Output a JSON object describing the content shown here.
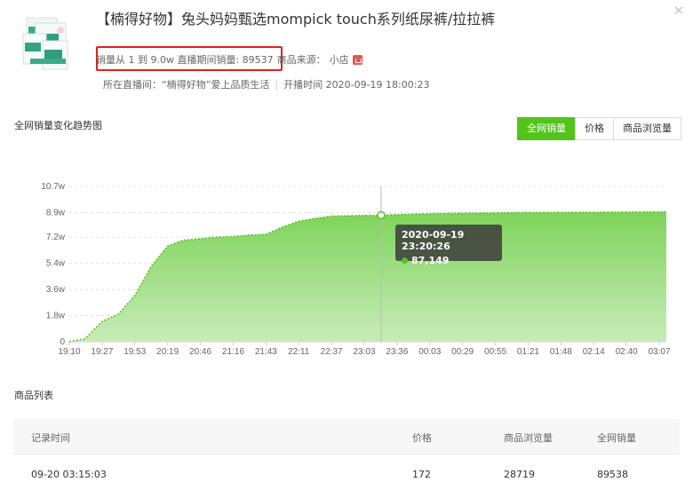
{
  "product": {
    "title": "【楠得好物】兔头妈妈甄选mompick touch系列纸尿裤/拉拉裤",
    "sales_summary": "销量从 1 到 9.0w 直播期间销量: 89537",
    "source_label": "商品来源：",
    "source_value": "小店",
    "live_label": "所在直播间：",
    "live_room": "“楠得好物”爱上品质生活",
    "live_time_label": "开播时间",
    "live_time": "2020-09-19 18:00:23"
  },
  "chart_section": {
    "title": "全网销量变化趋势图",
    "tabs": [
      "全网销量",
      "价格",
      "商品浏览量"
    ],
    "active_tab": "全网销量"
  },
  "tooltip": {
    "time": "2020-09-19 23:20:26",
    "value": "87,149"
  },
  "colors": {
    "accent": "#52c41a",
    "area_top": "#7ed35a",
    "area_bottom": "#c8ecb8",
    "highlight_box": "#e02020"
  },
  "chart_data": {
    "type": "area",
    "title": "全网销量变化趋势图",
    "xlabel": "",
    "ylabel": "",
    "x_ticks": [
      "19:10",
      "19:27",
      "19:53",
      "20:19",
      "20:46",
      "21:16",
      "21:43",
      "22:11",
      "22:37",
      "23:03",
      "23:36",
      "00:03",
      "00:29",
      "00:55",
      "01:21",
      "01:48",
      "02:14",
      "02:40",
      "03:07"
    ],
    "y_ticks": [
      "0",
      "1.8w",
      "3.6w",
      "5.4w",
      "7.2w",
      "8.9w",
      "10.7w"
    ],
    "ylim": [
      0,
      107000
    ],
    "grid": true,
    "x": [
      "19:10",
      "19:18",
      "19:27",
      "19:40",
      "19:53",
      "20:06",
      "20:19",
      "20:32",
      "20:46",
      "21:00",
      "21:16",
      "21:30",
      "21:43",
      "21:57",
      "22:11",
      "22:24",
      "22:37",
      "22:50",
      "23:03",
      "23:20",
      "23:36",
      "23:50",
      "00:03",
      "00:29",
      "00:55",
      "01:21",
      "01:48",
      "02:14",
      "02:40",
      "03:07",
      "03:15"
    ],
    "values": [
      1,
      2000,
      14000,
      19000,
      32000,
      52000,
      66000,
      70000,
      71000,
      72000,
      72500,
      73500,
      74000,
      79000,
      83000,
      85000,
      86500,
      86800,
      87000,
      87149,
      87600,
      88000,
      88300,
      88600,
      88800,
      89000,
      89100,
      89200,
      89300,
      89450,
      89538
    ],
    "highlight": {
      "x": "23:20",
      "time": "2020-09-19 23:20:26",
      "value": 87149
    }
  },
  "product_list": {
    "title": "商品列表",
    "columns": [
      "记录时间",
      "价格",
      "商品浏览量",
      "全网销量"
    ],
    "rows": [
      {
        "time": "09-20 03:15:03",
        "price": "172",
        "views": "28719",
        "sales": "89538"
      }
    ]
  }
}
